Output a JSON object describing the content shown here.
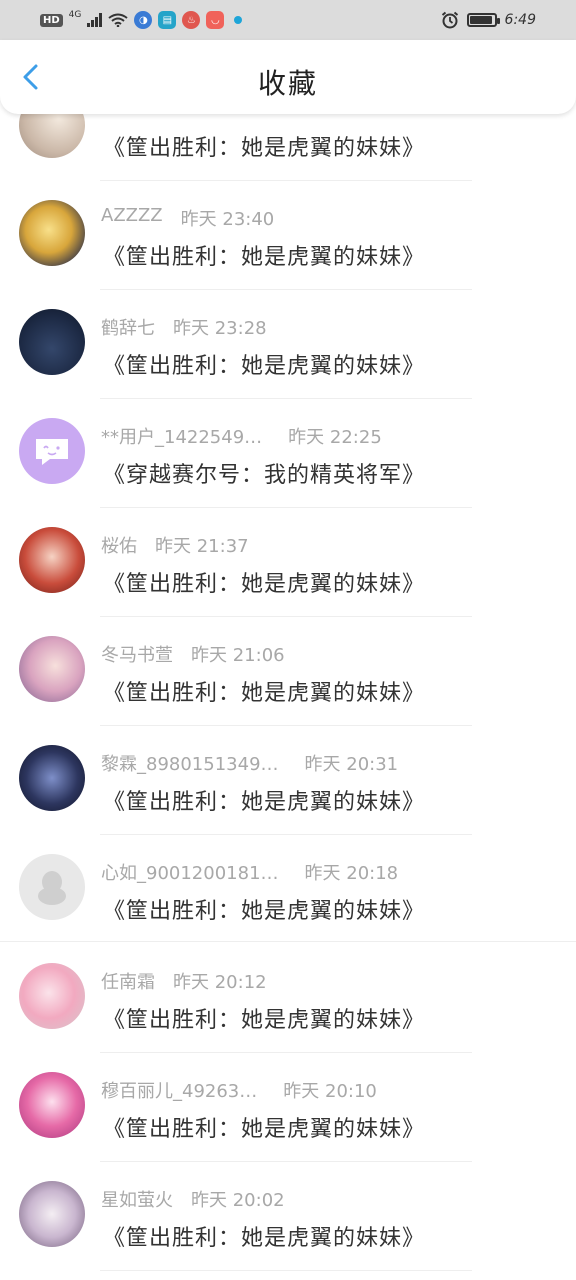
{
  "status_bar": {
    "hd_label": "HD",
    "network": "4G",
    "time": "6:49",
    "battery_level": 0.95,
    "icons": [
      "hd-icon",
      "signal-icon",
      "wifi-icon",
      "app-icon-browser",
      "app-icon-reader",
      "app-icon-news",
      "app-icon-store",
      "notification-dot-icon",
      "alarm-icon",
      "battery-icon"
    ]
  },
  "header": {
    "title": "收藏",
    "back_icon": "chevron-left-icon"
  },
  "colors": {
    "accent": "#3d9ee8",
    "meta_text": "#a8a8a8",
    "title_text": "#333333"
  },
  "items": [
    {
      "name": "",
      "time": "",
      "title": "《筐出胜利：她是虎翼的妹妹》",
      "avatar": "avatar-girl-beige"
    },
    {
      "name": "AZZZZ",
      "time": "昨天 23:40",
      "title": "《筐出胜利：她是虎翼的妹妹》",
      "avatar": "avatar-blonde-girl"
    },
    {
      "name": "鹤辞七",
      "time": "昨天 23:28",
      "title": "《筐出胜利：她是虎翼的妹妹》",
      "avatar": "avatar-blue-night"
    },
    {
      "name": "**用户_1422549…",
      "time": "昨天 22:25",
      "title": "《穿越赛尔号：我的精英将军》",
      "avatar": "avatar-purple-chat"
    },
    {
      "name": "桜佑",
      "time": "昨天 21:37",
      "title": "《筐出胜利：她是虎翼的妹妹》",
      "avatar": "avatar-red-girl"
    },
    {
      "name": "冬马书萱",
      "time": "昨天 21:06",
      "title": "《筐出胜利：她是虎翼的妹妹》",
      "avatar": "avatar-pink-photo"
    },
    {
      "name": "黎霖_8980151349…",
      "time": "昨天 20:31",
      "title": "《筐出胜利：她是虎翼的妹妹》",
      "avatar": "avatar-dark-anime"
    },
    {
      "name": "心如_9001200181…",
      "time": "昨天 20:18",
      "title": "《筐出胜利：她是虎翼的妹妹》",
      "avatar": "avatar-default-penguin"
    },
    {
      "name": "任南霜",
      "time": "昨天 20:12",
      "title": "《筐出胜利：她是虎翼的妹妹》",
      "avatar": "avatar-pink-hair"
    },
    {
      "name": "穆百丽儿_49263…",
      "time": "昨天 20:10",
      "title": "《筐出胜利：她是虎翼的妹妹》",
      "avatar": "avatar-magenta-girl"
    },
    {
      "name": "星如萤火",
      "time": "昨天 20:02",
      "title": "《筐出胜利：她是虎翼的妹妹》",
      "avatar": "avatar-floral-girl"
    }
  ]
}
